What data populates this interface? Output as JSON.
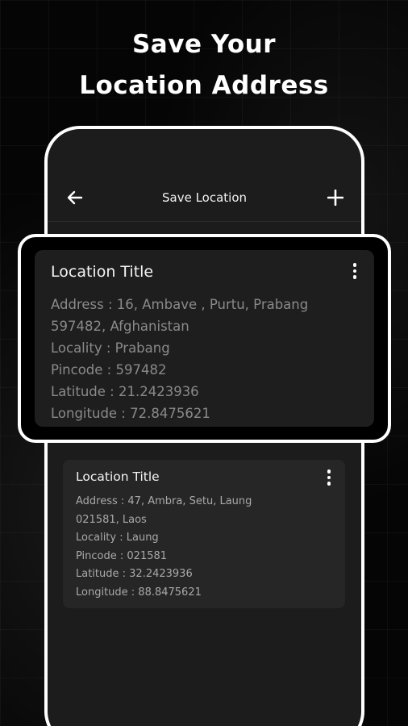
{
  "headline": {
    "line1": "Save Your",
    "line2": "Location Address"
  },
  "appbar": {
    "title": "Save Location",
    "back_icon": "arrow-left-icon",
    "add_icon": "plus-icon"
  },
  "locations": [
    {
      "title": "Location Title",
      "address_line1": "Address : 16, Ambave , Purtu, Prabang",
      "address_line2": "597482, Afghanistan",
      "locality": "Locality : Prabang",
      "pincode": "Pincode : 597482",
      "latitude": "Latitude : 21.2423936",
      "longitude": "Longitude : 72.8475621"
    },
    {
      "title": "Location Title",
      "address_line1": "Address : 47, Ambra, Setu, Laung",
      "address_line2": "021581, Laos",
      "locality": "Locality : Laung",
      "pincode": "Pincode : 021581",
      "latitude": "Latitude : 32.2423936",
      "longitude": "Longitude : 88.8475621"
    }
  ],
  "colors": {
    "background": "#000000",
    "card": "#1e1e1e",
    "text_primary": "#f4f4f4",
    "text_secondary": "#8a8a8a",
    "frame": "#ffffff"
  }
}
